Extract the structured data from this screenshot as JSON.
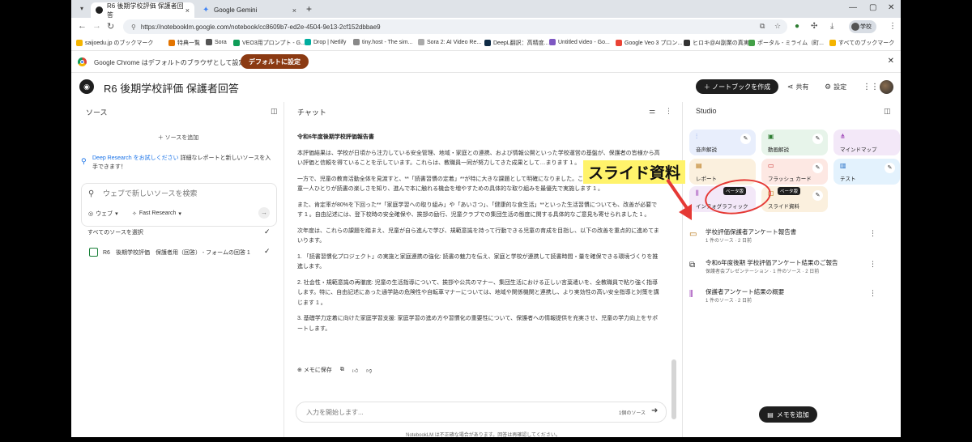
{
  "browser": {
    "tabs": [
      {
        "title": "R6 後期学校評価 保護者回答",
        "active": true
      },
      {
        "title": "Google Gemini",
        "active": false
      }
    ],
    "url": "https://notebooklm.google.com/notebook/cc8609b7-ed2e-4504-9e13-2cf152dbbae9",
    "profile_label": "学校",
    "bookmarks": [
      {
        "label": "saijoedu.jp のブックマーク",
        "color": "#f4b400"
      },
      {
        "label": "特典一覧",
        "color": "#e37400"
      },
      {
        "label": "Sora",
        "color": "#555555"
      },
      {
        "label": "VEO3用プロンプト - G...",
        "color": "#0f9d58"
      },
      {
        "label": "Drop | Netlify",
        "color": "#00ad9f"
      },
      {
        "label": "tiny.host - The sim...",
        "color": "#888888"
      },
      {
        "label": "Sora 2: AI Video Re...",
        "color": "#aaaaaa"
      },
      {
        "label": "DeepL翻訳：高精度...",
        "color": "#0f2b46"
      },
      {
        "label": "Untitled video - Go...",
        "color": "#7e57c2"
      },
      {
        "label": "Google Veo 3 プロン...",
        "color": "#ea4335"
      },
      {
        "label": "ヒロキ@AI副業の真実...",
        "color": "#333333"
      },
      {
        "label": "ポータル - ミライム（町...",
        "color": "#43a047"
      },
      {
        "label": "すべてのブックマーク",
        "color": "#f4b400"
      }
    ],
    "infobar": {
      "message": "Google Chrome はデフォルトのブラウザとして設定されていません",
      "button": "デフォルトに設定"
    }
  },
  "notebook": {
    "title": "R6 後期学校評価 保護者回答",
    "create_button": "＋ ノートブックを作成",
    "share": "共有",
    "settings": "設定"
  },
  "sources": {
    "header": "ソース",
    "add_source": "＋ ソースを追加",
    "deep_research_link": "Deep Research をお試しください",
    "deep_research_text": "詳細なレポートと新しいソースを入手できます！",
    "search_placeholder": "ウェブで新しいソースを検索",
    "chip_web": "ウェブ",
    "chip_fast": "Fast Research",
    "select_all": "すべてのソースを選択",
    "items": [
      {
        "label": "R6　後期学校評価　保護者用（回答） - フォームの回答 1"
      }
    ]
  },
  "chat": {
    "header": "チャット",
    "heading": "令和6年度後期学校評価報告書",
    "paragraphs": [
      "本評価結果は、学校が日頃から注力している安全管理、地域・家庭との連携、および情報公開といった学校運営の基盤が、保護者の皆様から高い評価と信頼を得ていることを示しています。これらは、教職員一同が努力してきた成果として…まります 1 。",
      "一方で、児童の教育活動全体を見渡すと、**「読書習慣の定着」**が特に大きな課題として明確になりました。この結果を受け、学校では、児童一人ひとりが読書の楽しさを知り、進んで本に触れる機会を増やすための具体的な取り組みを最優先で実施します 1 。",
      "また、肯定率が80%を下回った**「家庭学習への取り組み」や「あいさつ」、「健康的な食生活」**といった生活習慣についても、改善が必要です 1 。自由記述には、登下校時の安全確保や、挨拶の励行、児童クラブでの集団生活の態度に関する具体的なご意見も寄せられました 1 。",
      "次年度は、これらの課題を踏まえ、児童が自ら進んで学び、規範意識を持って行動できる児童の育成を目指し、以下の改善を重点的に進めてまいります。",
      "1. 「読書習慣化プロジェクト」の実施と家庭連携の強化: 読書の魅力を伝え、家庭と学校が連携して読書時間・量を確保できる環境づくりを推進します。",
      "2. 社会性・規範意識の再徹底: 児童の生活指導について、挨拶や公共のマナー、集団生活における正しい言葉遣いを、全教職員で粘り強く指導します。特に、自由記述にあった通学路の危険性や自転車マナーについては、地域や関係機関と連携し、より実効性の高い安全指導と対策を講じます 1 。",
      "3. 基礎学力定着に向けた家庭学習支援: 家庭学習の進め方や習慣化の重要性について、保護者への情報提供を充実させ、児童の学力向上をサポートします。"
    ],
    "save_memo": "メモに保存",
    "input_placeholder": "入力を開始します...",
    "source_count": "1個のソース",
    "footer": "NotebookLM は不正確な場合があります。回答は再確認してください。"
  },
  "studio": {
    "header": "Studio",
    "tools": [
      {
        "label": "音声解説",
        "icon": "audio-wave-icon",
        "color": "#e8eefc",
        "icolor": "#3c6bd8"
      },
      {
        "label": "動画解説",
        "icon": "video-icon",
        "color": "#e7f4ea",
        "icolor": "#2e7d32"
      },
      {
        "label": "マインドマップ",
        "icon": "mindmap-icon",
        "color": "#f3e8f8",
        "icolor": "#8e24aa"
      },
      {
        "label": "レポート",
        "icon": "report-icon",
        "color": "#fbf0de",
        "icolor": "#b26a00"
      },
      {
        "label": "フラッシュ カード",
        "icon": "flashcard-icon",
        "color": "#fde8e3",
        "icolor": "#c62828"
      },
      {
        "label": "テスト",
        "icon": "quiz-icon",
        "color": "#e3f2fd",
        "icolor": "#1565c0"
      },
      {
        "label": "インフォグラフィック",
        "icon": "infographic-icon",
        "color": "#f3e8f8",
        "icolor": "#8e24aa",
        "beta": "ベータ版"
      },
      {
        "label": "スライド資料",
        "icon": "slides-icon",
        "color": "#fbf0de",
        "icolor": "#b26a00",
        "beta": "ベータ版"
      }
    ],
    "notes": [
      {
        "title": "学校評価保護者アンケート報告書",
        "sub": "1 件のソース · 2 日前",
        "icon": "slides-icon"
      },
      {
        "title": "令和6年度後期 学校評価アンケート結果のご報告",
        "sub": "保護者会プレゼンテーション · 1 件のソース · 2 日前",
        "icon": "video-icon"
      },
      {
        "title": "保護者アンケート結果の概要",
        "sub": "1 件のソース · 2 日前",
        "icon": "infographic-icon"
      }
    ],
    "add_memo": "メモを追加"
  },
  "annotation": {
    "label": "スライド資料",
    "highlight_color": "#fff36b",
    "marker_color": "#e53935"
  }
}
